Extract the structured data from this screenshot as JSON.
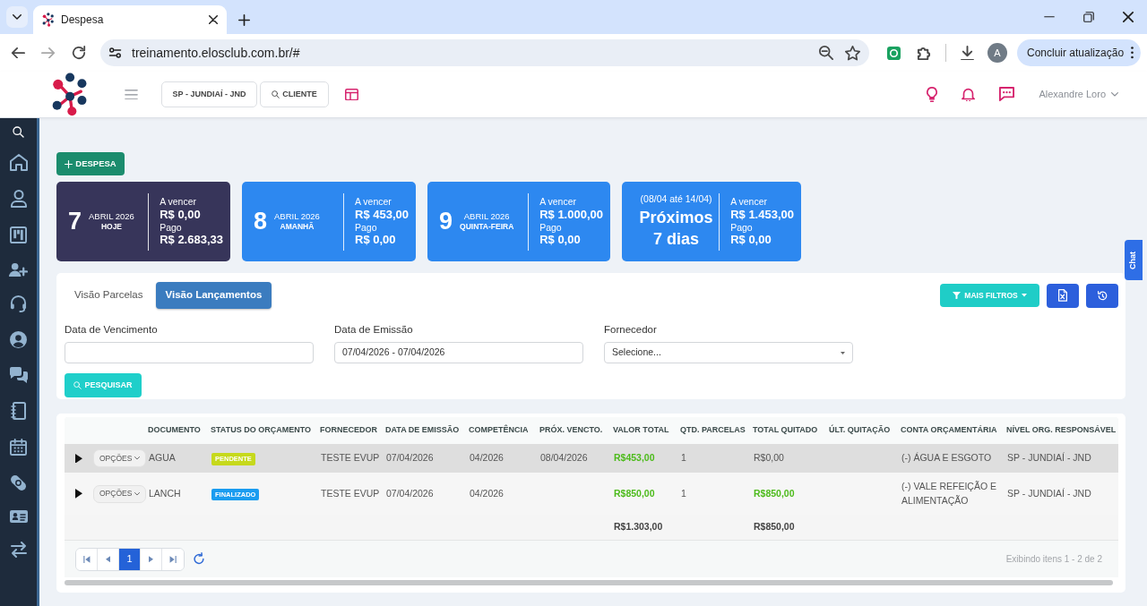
{
  "browser": {
    "tabs": [
      {
        "title": "Despesa",
        "selected": true
      }
    ],
    "url": "treinamento.elosclub.com.br/#",
    "profile_initial": "A",
    "update_button": "Concluir atualização"
  },
  "header": {
    "unit_button": "SP - JUNDIAÍ - JND",
    "client_button": "CLIENTE",
    "user_name": "Alexandre Loro"
  },
  "new_button": "DESPESA",
  "summary_cards": [
    {
      "kind": "day",
      "day": "7",
      "month": "ABRIL 2026",
      "weekday": "HOJE",
      "color": "#37355a",
      "due_label": "A vencer",
      "due": "R$ 0,00",
      "paid_label": "Pago",
      "paid": "R$ 2.683,33"
    },
    {
      "kind": "day",
      "day": "8",
      "month": "ABRIL 2026",
      "weekday": "AMANHÃ",
      "color": "#2d88f0",
      "due_label": "A vencer",
      "due": "R$ 453,00",
      "paid_label": "Pago",
      "paid": "R$ 0,00"
    },
    {
      "kind": "day",
      "day": "9",
      "month": "ABRIL 2026",
      "weekday": "QUINTA-FEIRA",
      "color": "#2d88f0",
      "due_label": "A vencer",
      "due": "R$ 1.000,00",
      "paid_label": "Pago",
      "paid": "R$ 0,00"
    },
    {
      "kind": "range",
      "range": "(08/04 até 14/04)",
      "title": "Próximos 7 dias",
      "color": "#2d88f0",
      "due_label": "A vencer",
      "due": "R$ 1.453,00",
      "paid_label": "Pago",
      "paid": "R$ 0,00"
    }
  ],
  "view_tabs": [
    {
      "label": "Visão Parcelas",
      "selected": false
    },
    {
      "label": "Visão Lançamentos",
      "selected": true
    }
  ],
  "more_filters_button": "MAIS FILTROS",
  "filters": [
    {
      "kind": "text",
      "label": "Data de Vencimento"
    },
    {
      "kind": "text",
      "label": "Data de Emissão",
      "value": "07/04/2026 - 07/04/2026"
    },
    {
      "kind": "select",
      "label": "Fornecedor",
      "value": "Selecione..."
    }
  ],
  "search_button": "PESQUISAR",
  "table": {
    "columns": [
      "DOCUMENTO",
      "STATUS DO ORÇAMENTO",
      "FORNECEDOR",
      "DATA DE EMISSÃO",
      "COMPETÊNCIA",
      "PRÓX. VENCTO.",
      "VALOR TOTAL",
      "QTD. PARCELAS",
      "TOTAL QUITADO",
      "ÚLT. QUITAÇÃO",
      "CONTA ORÇAMENTÁRIA",
      "NÍVEL ORG. RESPONSÁVEL"
    ],
    "rows": [
      {
        "highlighted": true,
        "options_button": "OPÇÕES",
        "document": "AGUA",
        "status": {
          "label": "PENDENTE",
          "color": "#c6d91c"
        },
        "supplier": "TESTE EVUP",
        "issue_date": "07/04/2026",
        "competence": "04/2026",
        "next_due": "08/04/2026",
        "total_value": {
          "text": "R$453,00",
          "highlight": true
        },
        "installments": "1",
        "total_paid": {
          "text": "R$0,00",
          "highlight": false
        },
        "budget_account": "(-) ÁGUA E ESGOTO",
        "org_level": "SP - JUNDIAÍ - JND"
      },
      {
        "highlighted": false,
        "options_button": "OPÇÕES",
        "document": "LANCH",
        "status": {
          "label": "FINALIZADO",
          "color": "#1a9cf0"
        },
        "supplier": "TESTE EVUP",
        "issue_date": "07/04/2026",
        "competence": "04/2026",
        "total_value": {
          "text": "R$850,00",
          "highlight": true
        },
        "installments": "1",
        "total_paid": {
          "text": "R$850,00",
          "highlight": true
        },
        "budget_account": "(-) VALE REFEIÇÃO E ALIMENTAÇÃO",
        "org_level": "SP - JUNDIAÍ - JND"
      }
    ],
    "totals": {
      "total_value": "R$1.303,00",
      "total_paid": "R$850,00"
    }
  },
  "pager": {
    "pages": [
      {
        "label": "1",
        "selected": true
      }
    ],
    "info": "Exibindo itens 1 - 2 de 2"
  },
  "chat_tab": "Chat"
}
